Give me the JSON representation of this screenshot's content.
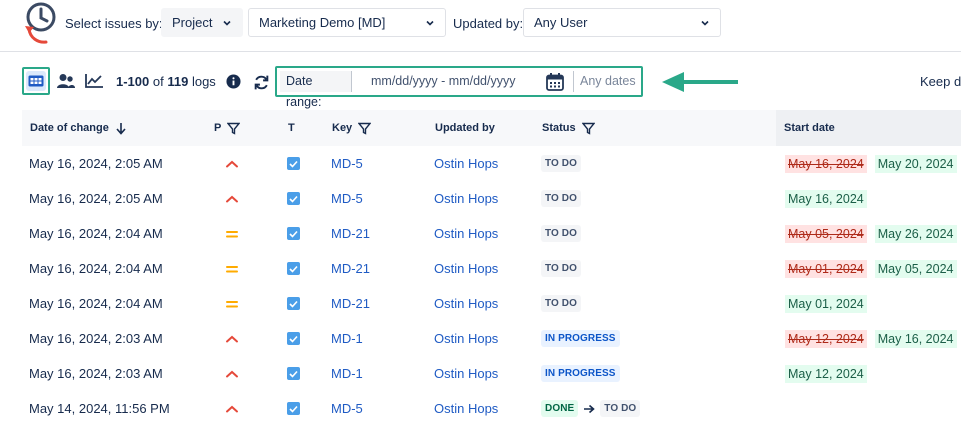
{
  "filters": {
    "select_label": "Select issues by:",
    "project_label": "Project",
    "project_value": "Marketing Demo [MD]",
    "updated_label": "Updated by:",
    "updated_value": "Any User"
  },
  "toolbar": {
    "range": "1-100",
    "of": "of",
    "total": "119",
    "unit": "logs",
    "date_range_label": "Date range:",
    "date_range_placeholder": "mm/dd/yyyy - mm/dd/yyyy",
    "any_dates": "Any dates",
    "keep_text": "Keep d"
  },
  "table": {
    "headers": {
      "date": "Date of change",
      "p": "P",
      "t": "T",
      "key": "Key",
      "updated_by": "Updated by",
      "status": "Status",
      "start": "Start date"
    },
    "rows": [
      {
        "date": "May 16, 2024, 2:05 AM",
        "priority": "high",
        "key": "MD-5",
        "user": "Ostin Hops",
        "status": "TO DO",
        "status_type": "todo",
        "old_date": "May 16, 2024",
        "new_date": "May 20, 2024"
      },
      {
        "date": "May 16, 2024, 2:05 AM",
        "priority": "high",
        "key": "MD-5",
        "user": "Ostin Hops",
        "status": "TO DO",
        "status_type": "todo",
        "old_date": "",
        "new_date": "May 16, 2024"
      },
      {
        "date": "May 16, 2024, 2:04 AM",
        "priority": "medium",
        "key": "MD-21",
        "user": "Ostin Hops",
        "status": "TO DO",
        "status_type": "todo",
        "old_date": "May 05, 2024",
        "new_date": "May 26, 2024"
      },
      {
        "date": "May 16, 2024, 2:04 AM",
        "priority": "medium",
        "key": "MD-21",
        "user": "Ostin Hops",
        "status": "TO DO",
        "status_type": "todo",
        "old_date": "May 01, 2024",
        "new_date": "May 05, 2024"
      },
      {
        "date": "May 16, 2024, 2:04 AM",
        "priority": "medium",
        "key": "MD-21",
        "user": "Ostin Hops",
        "status": "TO DO",
        "status_type": "todo",
        "old_date": "",
        "new_date": "May 01, 2024"
      },
      {
        "date": "May 16, 2024, 2:03 AM",
        "priority": "high",
        "key": "MD-1",
        "user": "Ostin Hops",
        "status": "IN PROGRESS",
        "status_type": "inprogress",
        "old_date": "May 12, 2024",
        "new_date": "May 16, 2024"
      },
      {
        "date": "May 16, 2024, 2:03 AM",
        "priority": "high",
        "key": "MD-1",
        "user": "Ostin Hops",
        "status": "IN PROGRESS",
        "status_type": "inprogress",
        "old_date": "",
        "new_date": "May 12, 2024"
      },
      {
        "date": "May 14, 2024, 11:56 PM",
        "priority": "high",
        "key": "MD-5",
        "user": "Ostin Hops",
        "status": "DONE",
        "status_type": "done",
        "status_to": "TO DO",
        "old_date": "",
        "new_date": ""
      }
    ]
  },
  "colors": {
    "accent": "#2aa889",
    "link": "#1f5bc4",
    "priority_high": "#e5493a",
    "priority_medium": "#ffab00",
    "checkbox": "#4a9ee8"
  },
  "icons": [
    "clock-history-icon",
    "table-view-icon",
    "users-icon",
    "chart-icon",
    "info-icon",
    "refresh-icon",
    "calendar-icon",
    "filter-icon",
    "sort-down-icon",
    "chevron-down-icon",
    "arrow-left-icon"
  ]
}
